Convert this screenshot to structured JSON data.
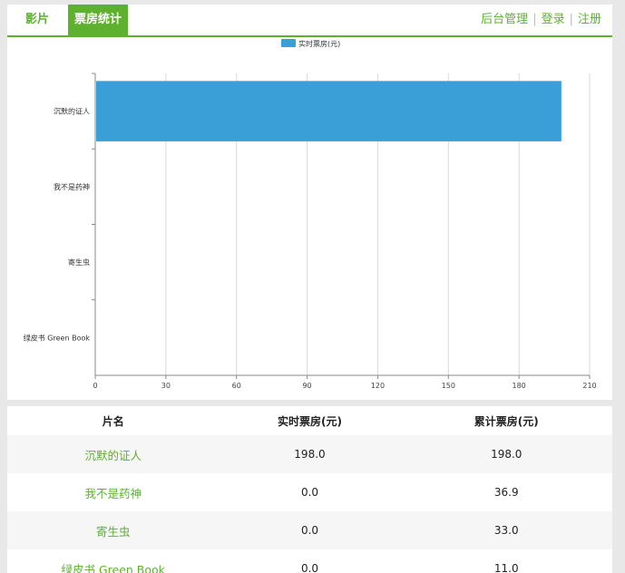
{
  "nav": {
    "tab_movies": "影片",
    "tab_boxoffice": "票房统计",
    "admin": "后台管理",
    "login": "登录",
    "register": "注册",
    "separator": "|"
  },
  "colors": {
    "accent": "#5db12f",
    "bar": "#3a9fd6"
  },
  "chart_data": {
    "type": "bar",
    "orientation": "horizontal",
    "categories": [
      "沉默的证人",
      "我不是药神",
      "寄生虫",
      "绿皮书 Green Book"
    ],
    "series": [
      {
        "name": "实时票房(元)",
        "values": [
          198.0,
          0.0,
          0.0,
          0.0
        ]
      }
    ],
    "xlim": [
      0,
      210
    ],
    "xticks": [
      0,
      30,
      60,
      90,
      120,
      150,
      180,
      210
    ],
    "grid": true,
    "legend": "top-center"
  },
  "table": {
    "headers": [
      "片名",
      "实时票房(元)",
      "累计票房(元)"
    ],
    "rows": [
      {
        "name": "沉默的证人",
        "realtime": "198.0",
        "total": "198.0"
      },
      {
        "name": "我不是药神",
        "realtime": "0.0",
        "total": "36.9"
      },
      {
        "name": "寄生虫",
        "realtime": "0.0",
        "total": "33.0"
      },
      {
        "name": "绿皮书 Green Book",
        "realtime": "0.0",
        "total": "11.0"
      }
    ]
  }
}
